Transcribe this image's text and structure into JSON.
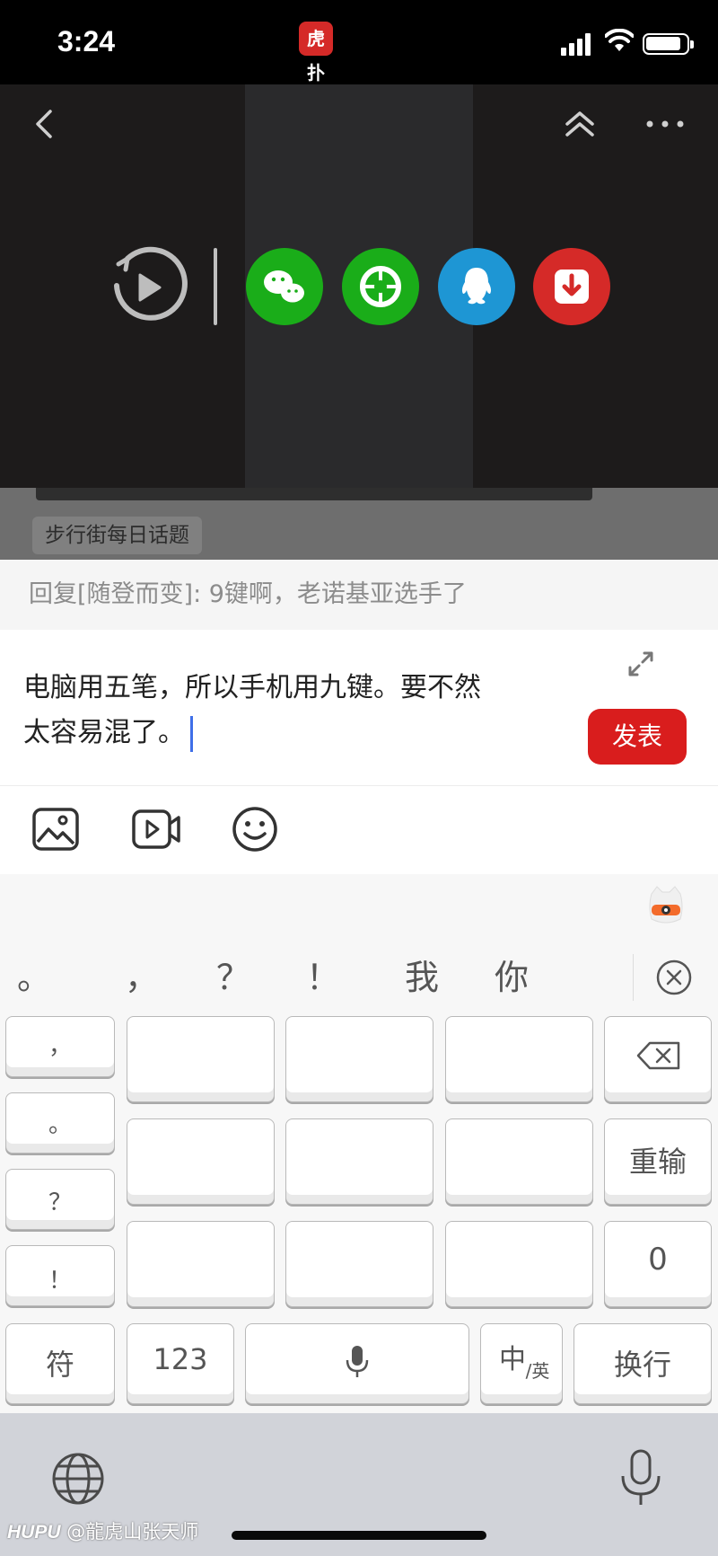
{
  "status_bar": {
    "time": "3:24",
    "app_logo_text": "虎扑"
  },
  "video_overlay": {
    "icons": [
      "back-icon",
      "collapse-icon",
      "more-icon",
      "replay-icon"
    ],
    "share_targets": [
      {
        "name": "wechat",
        "color": "#1aad19"
      },
      {
        "name": "moments",
        "color": "#1aad19"
      },
      {
        "name": "qq",
        "color": "#1e96d4"
      },
      {
        "name": "download",
        "color": "#d52a28"
      }
    ]
  },
  "topic_tag": "步行街每日话题",
  "reply": {
    "reply_to_text": "回复[随登而变]: 9键啊，老诺基亚选手了",
    "draft_line1": "电脑用五笔，所以手机用九键。要不然",
    "draft_line2": "太容易混了。",
    "post_button": "发表",
    "toolbar_icons": [
      "image-icon",
      "video-icon",
      "emoji-icon"
    ]
  },
  "keyboard": {
    "candidates": [
      "。",
      "，",
      "？",
      "！",
      "我",
      "你"
    ],
    "punctuation_keys": [
      "，",
      "。",
      "？",
      "！"
    ],
    "right_keys": {
      "retype": "重输",
      "zero": "0"
    },
    "bottom_keys": {
      "symbols": "符",
      "numbers": "123",
      "lang_main": "中",
      "lang_sub": "/英",
      "newline": "换行"
    }
  },
  "watermark": {
    "brand": "HUPU",
    "handle": "@龍虎山张天师"
  },
  "colors": {
    "accent_red": "#d91d1d",
    "caret_blue": "#3f6fe8"
  }
}
